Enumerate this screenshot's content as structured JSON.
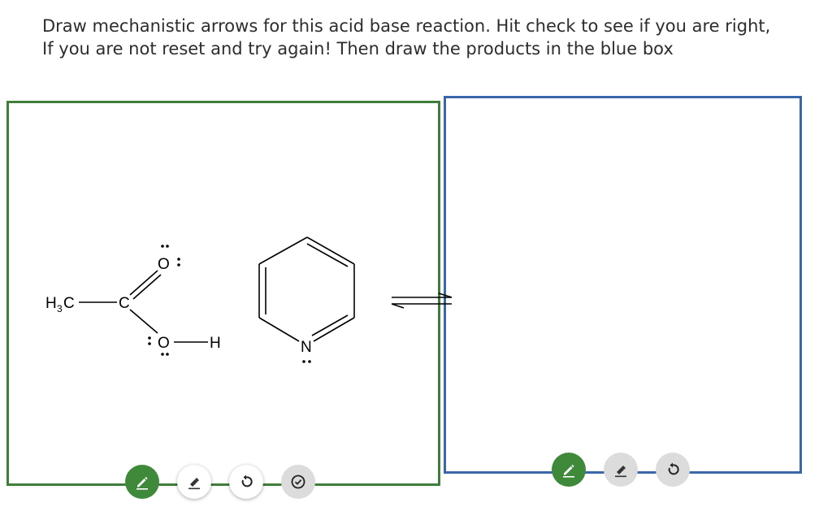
{
  "instructions": {
    "line1": "Draw mechanistic arrows for this acid base reaction. Hit check to see if you are right,",
    "line2": "If you are not reset and try again! Then draw the products in the blue box"
  },
  "molecules": {
    "acetic_acid": {
      "methyl": "H",
      "methyl_sub": "3",
      "methyl_c": "C",
      "carbon": "C",
      "carbonyl_o": "O",
      "hydroxyl_o": "O",
      "hydrogen": "H",
      "lone_pair": ":"
    },
    "pyridine": {
      "nitrogen": "N",
      "lone_pair": ".."
    }
  },
  "left_panel": {
    "border_color": "#3f7e3a",
    "tools": [
      {
        "name": "pen-tool-button",
        "icon": "pencil-icon",
        "state": "active"
      },
      {
        "name": "eraser-tool-button",
        "icon": "eraser-icon",
        "state": "normal"
      },
      {
        "name": "reset-button",
        "icon": "reset-icon",
        "state": "normal"
      },
      {
        "name": "check-button",
        "icon": "check-circle-icon",
        "state": "disabled"
      }
    ]
  },
  "right_panel": {
    "border_color": "#3b66a8",
    "tools": [
      {
        "name": "pen-tool-button",
        "icon": "pencil-icon",
        "state": "active"
      },
      {
        "name": "eraser-tool-button",
        "icon": "eraser-icon",
        "state": "disabled"
      },
      {
        "name": "reset-button",
        "icon": "reset-icon",
        "state": "disabled"
      }
    ]
  },
  "colors": {
    "active_tool": "#3f8a3a",
    "disabled_tool": "#dcdcdc"
  }
}
